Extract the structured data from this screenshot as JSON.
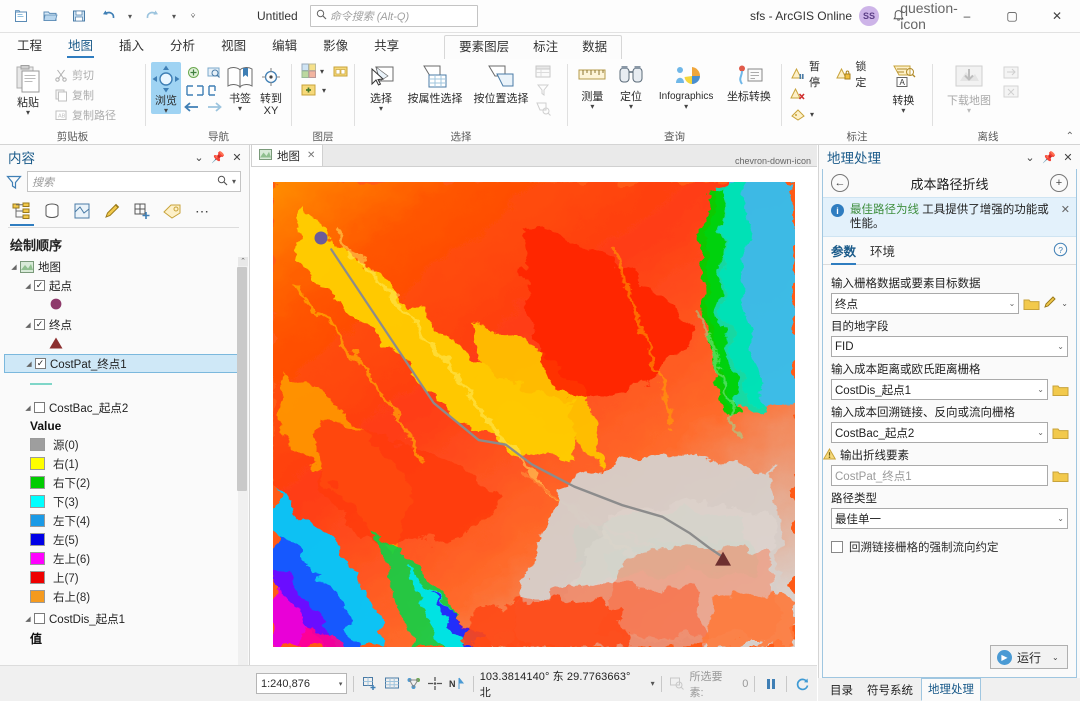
{
  "titlebar": {
    "quick_access": [
      "new-project-icon",
      "open-project-icon",
      "save-project-icon",
      "undo-icon",
      "redo-icon",
      "customize-qat-icon"
    ],
    "project_title": "Untitled",
    "search": {
      "placeholder": "命令搜索 (Alt-Q)",
      "icon": "search-icon"
    },
    "account": "sfs - ArcGIS Online",
    "avatar_initials": "SS",
    "notification_icon": "bell-icon",
    "help_icon": "question-icon",
    "minimize": "–",
    "maximize": "▢",
    "close": "✕"
  },
  "ribbon": {
    "tabs": [
      {
        "label": "工程",
        "active": false
      },
      {
        "label": "地图",
        "active": true
      },
      {
        "label": "插入",
        "active": false
      },
      {
        "label": "分析",
        "active": false
      },
      {
        "label": "视图",
        "active": false
      },
      {
        "label": "编辑",
        "active": false
      },
      {
        "label": "影像",
        "active": false
      },
      {
        "label": "共享",
        "active": false
      }
    ],
    "contextual_tabs": [
      {
        "label": "要素图层",
        "active": false
      },
      {
        "label": "标注",
        "active": false
      },
      {
        "label": "数据",
        "active": false
      }
    ],
    "groups": [
      {
        "name": "剪贴板",
        "big": [
          {
            "label": "粘贴",
            "icon": "paste-icon",
            "has_caret": true
          }
        ],
        "small": [
          {
            "label": "剪切",
            "icon": "cut-icon",
            "disabled": true
          },
          {
            "label": "复制",
            "icon": "copy-icon",
            "disabled": true
          },
          {
            "label": "复制路径",
            "icon": "copy-path-icon",
            "disabled": true
          }
        ]
      },
      {
        "name": "导航",
        "big": [
          {
            "label": "浏览",
            "icon": "explore-icon",
            "has_caret": true,
            "selected": true
          },
          {
            "label": "书签",
            "icon": "bookmark-icon",
            "has_caret": true
          },
          {
            "label": "转到 XY",
            "icon": "go-to-xy-icon",
            "has_caret": false
          }
        ],
        "small": [
          {
            "label": "",
            "icon": "fixed-zoom-in-icon"
          },
          {
            "label": "",
            "icon": "zoom-to-layer-icon"
          },
          {
            "label": "",
            "icon": "previous-extent-icon"
          },
          {
            "label": "",
            "icon": "next-extent-icon"
          }
        ]
      },
      {
        "name": "图层",
        "small": [
          {
            "label": "",
            "icon": "basemap-icon",
            "has_caret": true
          },
          {
            "label": "",
            "icon": "add-preset-icon"
          },
          {
            "label": "",
            "icon": "add-data-icon",
            "has_caret": true
          }
        ]
      },
      {
        "name": "选择",
        "big": [
          {
            "label": "选择",
            "icon": "select-icon",
            "has_caret": true
          },
          {
            "label": "按属性选择",
            "icon": "select-by-attributes-icon"
          },
          {
            "label": "按位置选择",
            "icon": "select-by-location-icon"
          }
        ],
        "small": [
          {
            "label": "",
            "icon": "attribute-table-icon",
            "disabled": true
          },
          {
            "label": "",
            "icon": "clear-selection-icon",
            "disabled": true
          },
          {
            "label": "",
            "icon": "zoom-to-selection-icon",
            "disabled": true
          }
        ]
      },
      {
        "name": "查询",
        "big": [
          {
            "label": "测量",
            "icon": "measure-icon",
            "has_caret": true
          },
          {
            "label": "定位",
            "icon": "locate-icon",
            "has_caret": true
          },
          {
            "label": "Infographics",
            "icon": "infographics-icon",
            "has_caret": true
          },
          {
            "label": "坐标转换",
            "icon": "coordinate-conversion-icon"
          }
        ]
      },
      {
        "name": "标注",
        "big": [
          {
            "label": "转换",
            "icon": "convert-labels-icon",
            "has_caret": true
          }
        ],
        "small": [
          {
            "label": "暂停",
            "icon": "pause-labels-icon"
          },
          {
            "label": "锁定",
            "icon": "lock-labels-icon"
          },
          {
            "label": "",
            "icon": "remove-labels-icon"
          },
          {
            "label": "",
            "icon": "more-labeling-icon",
            "has_caret": true
          }
        ]
      },
      {
        "name": "离线",
        "big": [
          {
            "label": "下载地图",
            "icon": "download-map-icon",
            "has_caret": true,
            "disabled": true
          }
        ],
        "small": [
          {
            "label": "",
            "icon": "sync-icon",
            "disabled": true
          },
          {
            "label": "",
            "icon": "remove-offline-icon",
            "disabled": true
          }
        ]
      }
    ]
  },
  "contents": {
    "title": "内容",
    "filter_placeholder": "搜索",
    "tabs": [
      "drawing-order-icon",
      "data-source-icon",
      "selection-icon",
      "editing-icon",
      "snapping-icon",
      "labeling-icon",
      "more-icon"
    ],
    "section_title": "绘制顺序",
    "tree": [
      {
        "label": "地图",
        "type": "map",
        "indent": 0,
        "expanded": true
      },
      {
        "label": "起点",
        "type": "layer",
        "indent": 1,
        "checked": true,
        "expanded": true
      },
      {
        "label": "",
        "type": "symbol-point",
        "indent": 2,
        "color": "#8e3a6b"
      },
      {
        "label": "终点",
        "type": "layer",
        "indent": 1,
        "checked": true,
        "expanded": true
      },
      {
        "label": "",
        "type": "symbol-triangle",
        "indent": 2,
        "color": "#8c2f2f"
      },
      {
        "label": "CostPat_终点1",
        "type": "layer",
        "indent": 1,
        "checked": true,
        "expanded": true,
        "selected": true
      },
      {
        "label": "",
        "type": "symbol-line",
        "indent": 2,
        "color": "#7fd6c8"
      },
      {
        "label": "CostBac_起点2",
        "type": "layer",
        "indent": 1,
        "checked": false,
        "expanded": true
      },
      {
        "label": "Value",
        "type": "value-header",
        "indent": 2
      },
      {
        "label": "CostDis_起点1",
        "type": "layer",
        "indent": 1,
        "checked": false,
        "expanded": true
      },
      {
        "label": "值",
        "type": "value-header",
        "indent": 2
      }
    ],
    "legend": [
      {
        "label": "源(0)",
        "color": "#9e9e9e"
      },
      {
        "label": "右(1)",
        "color": "#ffff00"
      },
      {
        "label": "右下(2)",
        "color": "#00cc00"
      },
      {
        "label": "下(3)",
        "color": "#00ffff"
      },
      {
        "label": "左下(4)",
        "color": "#1a9ae6"
      },
      {
        "label": "左(5)",
        "color": "#0000e6"
      },
      {
        "label": "左上(6)",
        "color": "#ff00ff"
      },
      {
        "label": "上(7)",
        "color": "#ee0000"
      },
      {
        "label": "右上(8)",
        "color": "#f59a1e"
      }
    ]
  },
  "map": {
    "tab_label": "地图",
    "tab_icon": "map-icon",
    "close_icon": "✕",
    "dropdown_icon": "chevron-down-icon",
    "markers": {
      "start": {
        "name": "起点",
        "color": "#6b5b9a"
      },
      "end": {
        "name": "终点",
        "color": "#6e2f2f"
      }
    },
    "path_color": "#9a9a9a"
  },
  "status": {
    "scale": "1:240,876",
    "tools": [
      "add-graphic-icon",
      "grid-icon",
      "measure-status-icon",
      "crosshair-icon",
      "north-icon"
    ],
    "coordinates": "103.3814140° 东  29.7763663° 北",
    "selection_label": "所选要素:",
    "selection_count": "0",
    "pause_icon": "pause-drawing-icon",
    "refresh_icon": "refresh-icon"
  },
  "geoprocessing": {
    "title": "地理处理",
    "back_icon": "back-arrow-icon",
    "tool_name": "成本路径折线",
    "add_icon": "plus-icon",
    "banner": {
      "icon": "info-icon",
      "link_text": "最佳路径为线",
      "text": " 工具提供了增强的功能或性能。",
      "close": "✕"
    },
    "tabs": [
      {
        "label": "参数",
        "active": true
      },
      {
        "label": "环境",
        "active": false
      }
    ],
    "help_icon": "help-circle-icon",
    "parameters": [
      {
        "label": "输入栅格数据或要素目标数据",
        "value": "终点",
        "type": "combo",
        "has_folder": true,
        "has_pencil": true
      },
      {
        "label": "目的地字段",
        "value": "FID",
        "type": "combo"
      },
      {
        "label": "输入成本距离或欧氏距离栅格",
        "value": "CostDis_起点1",
        "type": "combo",
        "has_folder": true
      },
      {
        "label": "输入成本回溯链接、反向或流向栅格",
        "value": "CostBac_起点2",
        "type": "combo",
        "has_folder": true
      },
      {
        "label": "输出折线要素",
        "value": "CostPat_终点1",
        "type": "text",
        "has_folder": true,
        "warning": true,
        "ghost": true
      },
      {
        "label": "路径类型",
        "value": "最佳单一",
        "type": "combo"
      }
    ],
    "checkbox": {
      "label": "回溯链接栅格的强制流向约定",
      "checked": false
    },
    "run_button": {
      "label": "运行",
      "icon": "run-icon",
      "has_caret": true
    },
    "bottom_tabs": [
      {
        "label": "目录",
        "active": false
      },
      {
        "label": "符号系统",
        "active": false
      },
      {
        "label": "地理处理",
        "active": true
      }
    ]
  }
}
